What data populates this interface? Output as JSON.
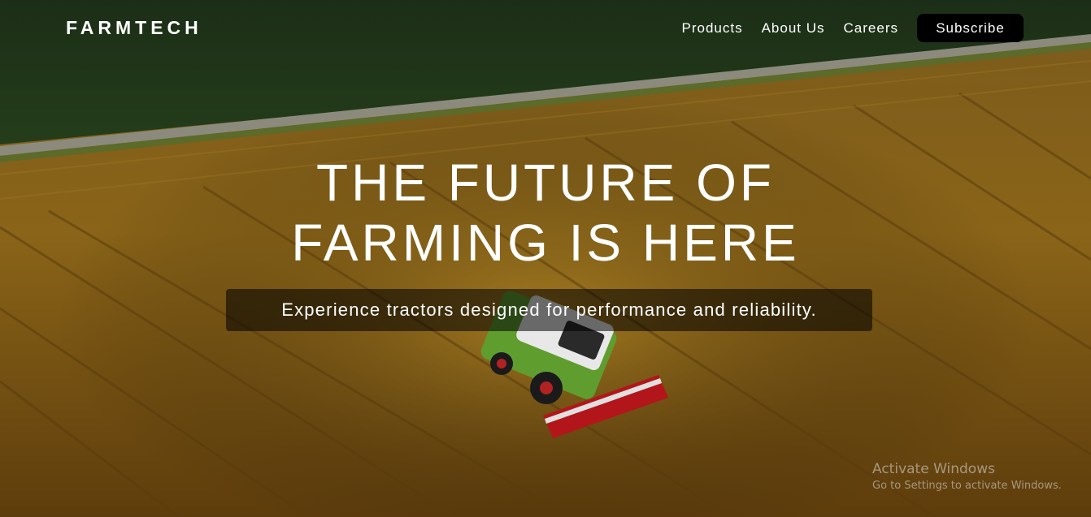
{
  "brand": {
    "name": "FARMTECH"
  },
  "nav": {
    "links": [
      "Products",
      "About Us",
      "Careers"
    ],
    "subscribe_label": "Subscribe"
  },
  "hero": {
    "headline_line1": "THE FUTURE OF",
    "headline_line2": "FARMING IS HERE",
    "tagline": "Experience tractors designed for performance and reliability."
  },
  "watermark": {
    "title": "Activate Windows",
    "subtitle": "Go to Settings to activate Windows."
  },
  "colors": {
    "field": "#8a5e14",
    "crop_green": "#1f3a17",
    "button_bg": "#000000",
    "text": "#ffffff"
  }
}
